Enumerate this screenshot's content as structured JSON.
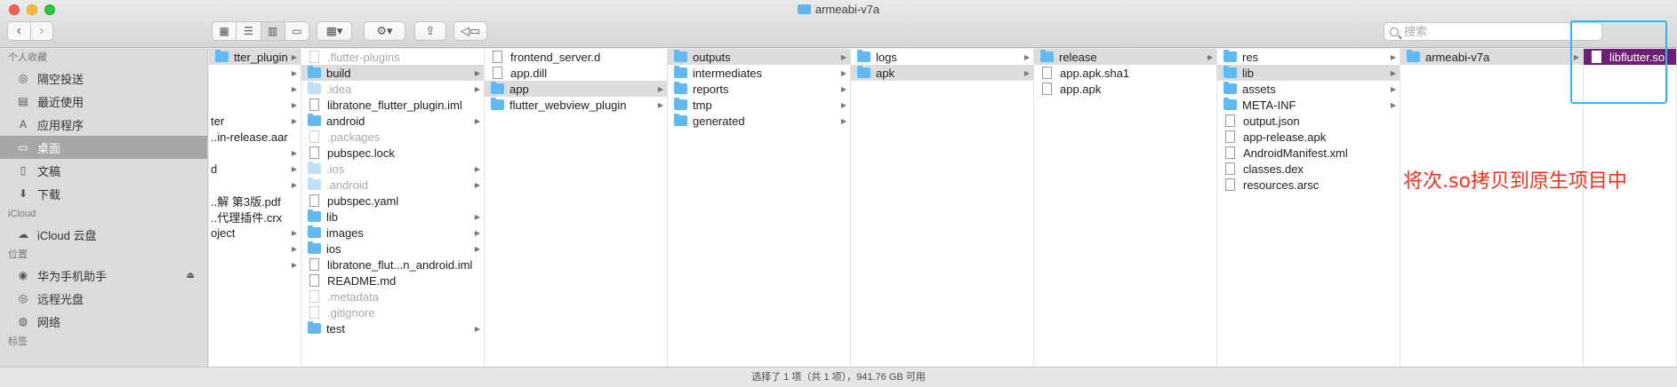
{
  "window": {
    "title": "armeabi-v7a",
    "status": "选择了 1 项（共 1 项），941.76 GB 可用"
  },
  "toolbar": {
    "search_placeholder": "搜索"
  },
  "sidebar": {
    "sections": [
      {
        "title": "个人收藏",
        "items": [
          {
            "label": "隔空投送",
            "icon": "airdrop-icon",
            "glyph": "◎"
          },
          {
            "label": "最近使用",
            "icon": "recents-icon",
            "glyph": "▤"
          },
          {
            "label": "应用程序",
            "icon": "applications-icon",
            "glyph": "A"
          },
          {
            "label": "桌面",
            "icon": "desktop-icon",
            "glyph": "▭",
            "selected": true
          },
          {
            "label": "文稿",
            "icon": "documents-icon",
            "glyph": "▯"
          },
          {
            "label": "下载",
            "icon": "downloads-icon",
            "glyph": "⬇"
          }
        ]
      },
      {
        "title": "iCloud",
        "items": [
          {
            "label": "iCloud 云盘",
            "icon": "icloud-icon",
            "glyph": "☁"
          }
        ]
      },
      {
        "title": "位置",
        "items": [
          {
            "label": "华为手机助手",
            "icon": "disk-icon",
            "glyph": "◉",
            "eject": "⏏"
          },
          {
            "label": "远程光盘",
            "icon": "remote-disc-icon",
            "glyph": "◎"
          },
          {
            "label": "网络",
            "icon": "network-icon",
            "glyph": "◍"
          }
        ]
      },
      {
        "title": "标签",
        "items": []
      }
    ]
  },
  "columns": [
    {
      "rows": [
        {
          "name": "tter_plugin",
          "type": "folder",
          "arrow": true,
          "sel": true
        },
        {
          "name": "",
          "type": "none",
          "arrow": true
        },
        {
          "name": "",
          "type": "none",
          "arrow": true
        },
        {
          "name": "",
          "type": "none",
          "arrow": true
        },
        {
          "name": "ter",
          "type": "none",
          "arrow": true
        },
        {
          "name": "..in-release.aar",
          "type": "none"
        },
        {
          "name": "",
          "type": "none",
          "arrow": true
        },
        {
          "name": "d",
          "type": "none",
          "arrow": true
        },
        {
          "name": "",
          "type": "none",
          "arrow": true
        },
        {
          "name": "..解 第3版.pdf",
          "type": "none"
        },
        {
          "name": "..代理插件.crx",
          "type": "none"
        },
        {
          "name": "oject",
          "type": "none",
          "arrow": true
        },
        {
          "name": "",
          "type": "none",
          "arrow": true
        },
        {
          "name": "",
          "type": "none",
          "arrow": true
        }
      ]
    },
    {
      "rows": [
        {
          "name": ".flutter-plugins",
          "type": "doc",
          "dim": true
        },
        {
          "name": "build",
          "type": "folder",
          "arrow": true,
          "sel": true
        },
        {
          "name": ".idea",
          "type": "folder",
          "arrow": true,
          "dim": true
        },
        {
          "name": "libratone_flutter_plugin.iml",
          "type": "doc"
        },
        {
          "name": "android",
          "type": "folder",
          "arrow": true
        },
        {
          "name": ".packages",
          "type": "doc",
          "dim": true
        },
        {
          "name": "pubspec.lock",
          "type": "doc"
        },
        {
          "name": ".ios",
          "type": "folder",
          "arrow": true,
          "dim": true
        },
        {
          "name": ".android",
          "type": "folder",
          "arrow": true,
          "dim": true
        },
        {
          "name": "pubspec.yaml",
          "type": "doc"
        },
        {
          "name": "lib",
          "type": "folder",
          "arrow": true
        },
        {
          "name": "images",
          "type": "folder",
          "arrow": true
        },
        {
          "name": "ios",
          "type": "folder",
          "arrow": true
        },
        {
          "name": "libratone_flut...n_android.iml",
          "type": "doc"
        },
        {
          "name": "README.md",
          "type": "doc"
        },
        {
          "name": ".metadata",
          "type": "doc",
          "dim": true
        },
        {
          "name": ".gitignore",
          "type": "doc",
          "dim": true
        },
        {
          "name": "test",
          "type": "folder",
          "arrow": true
        }
      ]
    },
    {
      "rows": [
        {
          "name": "frontend_server.d",
          "type": "doc"
        },
        {
          "name": "app.dill",
          "type": "doc"
        },
        {
          "name": "app",
          "type": "folder",
          "arrow": true,
          "sel": true
        },
        {
          "name": "flutter_webview_plugin",
          "type": "folder",
          "arrow": true
        }
      ]
    },
    {
      "rows": [
        {
          "name": "outputs",
          "type": "folder",
          "arrow": true,
          "sel": true
        },
        {
          "name": "intermediates",
          "type": "folder",
          "arrow": true
        },
        {
          "name": "reports",
          "type": "folder",
          "arrow": true
        },
        {
          "name": "tmp",
          "type": "folder",
          "arrow": true
        },
        {
          "name": "generated",
          "type": "folder",
          "arrow": true
        }
      ]
    },
    {
      "rows": [
        {
          "name": "logs",
          "type": "folder",
          "arrow": true
        },
        {
          "name": "apk",
          "type": "folder",
          "arrow": true,
          "sel": true
        }
      ]
    },
    {
      "rows": [
        {
          "name": "release",
          "type": "folder",
          "arrow": true,
          "sel": true
        },
        {
          "name": "app.apk.sha1",
          "type": "doc"
        },
        {
          "name": "app.apk",
          "type": "doc"
        }
      ]
    },
    {
      "rows": [
        {
          "name": "res",
          "type": "folder",
          "arrow": true
        },
        {
          "name": "lib",
          "type": "folder",
          "arrow": true,
          "sel": true
        },
        {
          "name": "assets",
          "type": "folder",
          "arrow": true
        },
        {
          "name": "META-INF",
          "type": "folder",
          "arrow": true
        },
        {
          "name": "output.json",
          "type": "doc"
        },
        {
          "name": "app-release.apk",
          "type": "doc"
        },
        {
          "name": "AndroidManifest.xml",
          "type": "doc"
        },
        {
          "name": "classes.dex",
          "type": "doc"
        },
        {
          "name": "resources.arsc",
          "type": "doc"
        }
      ]
    },
    {
      "rows": [
        {
          "name": "armeabi-v7a",
          "type": "folder",
          "arrow": true,
          "sel": true
        }
      ]
    },
    {
      "rows": [
        {
          "name": "libflutter.so",
          "type": "doc",
          "selblue": true
        }
      ]
    }
  ],
  "annotation": {
    "text": "将次.so拷贝到原生项目中",
    "color": "#f0321e",
    "box_color": "#36b4f0"
  }
}
